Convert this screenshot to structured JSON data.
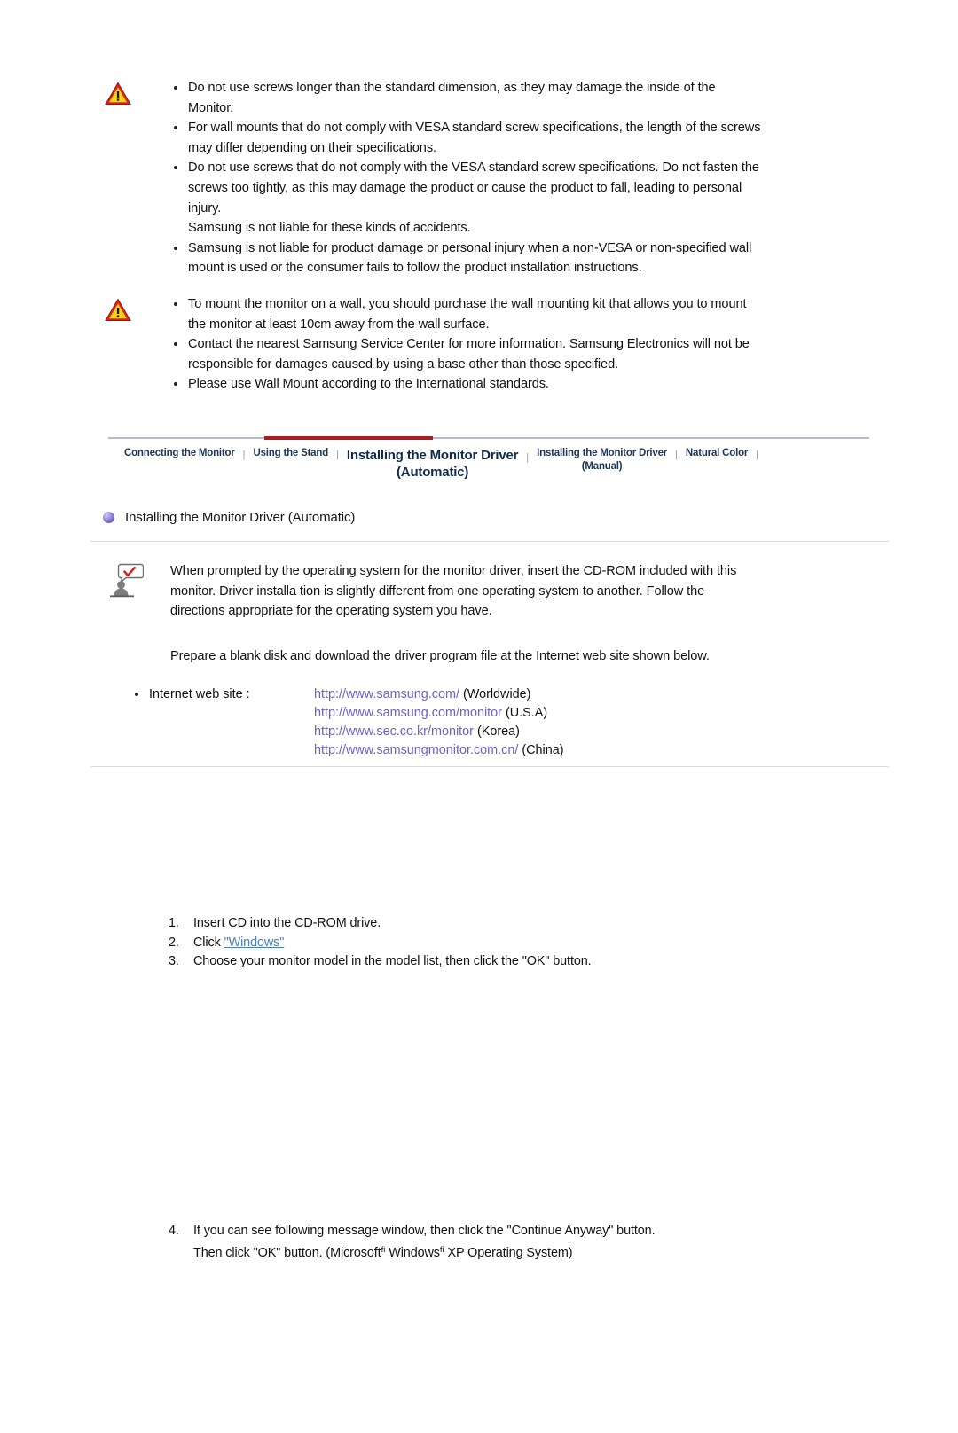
{
  "warnings": [
    {
      "icon": "warning-triangle-icon",
      "items": [
        "Do not use screws longer than the standard dimension, as they may damage the inside of the Monitor.",
        "For wall mounts that do not comply with VESA standard screw specifications, the length of the screws may differ depending on their specifications.",
        "Do not use screws that do not comply with the VESA standard screw specifications. Do not fasten the screws too tightly, as this may damage the product or cause the product to fall, leading to personal injury.\nSamsung is not liable for these kinds of accidents.",
        "Samsung is not liable for product damage or personal injury when a non-VESA or non-specified wall mount is used or the  consumer fails to follow the product installation instructions."
      ]
    },
    {
      "icon": "warning-triangle-icon",
      "items": [
        "To mount the monitor on a wall, you should purchase the wall mounting kit that allows you to mount the monitor at least 10cm away from the wall surface.",
        "Contact the nearest Samsung Service Center for more information. Samsung Electronics will not be responsible for damages caused by using a base other than those specified.",
        "Please use Wall Mount according to the International standards."
      ]
    }
  ],
  "tabnav": {
    "separator": "|",
    "active_color": "#a81d22",
    "rule_color": "#b7b7cd",
    "tabs": [
      {
        "label": "Connecting  the Monitor",
        "active": false
      },
      {
        "label": "Using the Stand",
        "active": false
      },
      {
        "label": "Installing the Monitor Driver\n(Automatic)",
        "active": true
      },
      {
        "label": "Installing the Monitor Driver\n(Manual)",
        "active": false
      },
      {
        "label": "Natural Color",
        "active": false
      }
    ]
  },
  "section": {
    "bullet_icon": "purple-sphere-bullet-icon",
    "title": "Installing the Monitor Driver (Automatic)"
  },
  "note": {
    "icon": "note-person-checkmark-icon",
    "paragraph_1": "When prompted by the operating system for the monitor driver, insert the CD-ROM included with this monitor. Driver installa      tion is slightly different from one operating system to another. Follow the directions appropriate for the operating system you have.",
    "paragraph_2": "Prepare a blank disk and download the driver program file at the Internet web site shown below."
  },
  "websites": {
    "label": "Internet web site :",
    "link_color": "#6a63c8",
    "entries": [
      {
        "url": "http://www.samsung.com/",
        "region": " (Worldwide)"
      },
      {
        "url": "http://www.samsung.com/monitor",
        "region": " (U.S.A)"
      },
      {
        "url": "http://www.sec.co.kr/monitor",
        "region": " (Korea)"
      },
      {
        "url": "http://www.samsungmonitor.com.cn/",
        "region": " (China)"
      }
    ]
  },
  "steps_group_1": [
    {
      "num": "1.",
      "text": "Insert CD into the CD-ROM drive."
    },
    {
      "num": "2.",
      "text_before": "Click ",
      "link": "\"Windows\"",
      "text_after": ""
    },
    {
      "num": "3.",
      "text": "Choose your monitor model in the model list, then click the \"OK\"  button."
    }
  ],
  "steps_group_2": [
    {
      "num": "4.",
      "line_1": "If you can see following message window, then click the \"Continue Anyway\"   button.",
      "line_2_a": "Then click \"OK\"  button. (Microsoft",
      "sup_1": "fi",
      "line_2_b": " Windows",
      "sup_2": "fi",
      "line_2_c": " XP Operating System)"
    }
  ]
}
